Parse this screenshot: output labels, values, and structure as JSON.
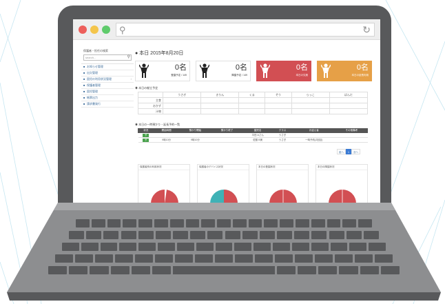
{
  "browser": {
    "search_icon": "search-icon",
    "refresh_icon": "refresh-icon",
    "traffic_lights": [
      "#ed5f5b",
      "#f4c54b",
      "#5fcb6b"
    ]
  },
  "sidebar": {
    "title": "保護者・担任の検索",
    "search_placeholder": "search...",
    "items": [
      {
        "label": "お知らせ管理",
        "icon": "home-icon"
      },
      {
        "label": "出欠管理",
        "icon": "calendar-icon"
      },
      {
        "label": "園児の利用状況管理",
        "icon": "list-icon"
      },
      {
        "label": "保護者管理",
        "icon": "user-icon"
      },
      {
        "label": "園児管理",
        "icon": "child-icon"
      },
      {
        "label": "帳票出力",
        "icon": "print-icon"
      },
      {
        "label": "請求書発行",
        "icon": "document-icon"
      }
    ]
  },
  "main": {
    "page_title": "本日 2015年8月20日",
    "stat_cards": [
      {
        "count": "0名",
        "sub": "登園予定 / 149",
        "style": "white"
      },
      {
        "count": "0名",
        "sub": "降園予定 / 149",
        "style": "white"
      },
      {
        "count": "0名",
        "sub": "本日の欠席",
        "style": "red"
      },
      {
        "count": "0名",
        "sub": "本日の延長利用",
        "style": "orange"
      }
    ],
    "schedule": {
      "title": "本日の献立予定",
      "columns": [
        "",
        "うさぎ",
        "きりん",
        "くま",
        "ぞう",
        "らっこ",
        "ぱんだ"
      ],
      "rows": [
        "主食",
        "おかず",
        "汁物"
      ]
    },
    "list": {
      "title": "本日の一時預かり・延長予約一覧",
      "columns": [
        "状況",
        "開始時間",
        "預かり開始",
        "預かり終了",
        "園児名",
        "クラス",
        "お迎え者",
        "その他備考"
      ],
      "rows": [
        {
          "tag": "予",
          "start": "",
          "from": "",
          "to": "",
          "name": "平田 Aさん",
          "cls": "うさぎ",
          "pickup": "",
          "note": ""
        },
        {
          "tag": "予",
          "start": "9時10分",
          "from": "9時10分",
          "to": "",
          "name": "佐藤 B美",
          "cls": "うさぎ",
          "pickup": "一時予約(2回目)",
          "note": ""
        }
      ]
    },
    "pager": {
      "prev": "前へ",
      "current": "1",
      "next": "次へ"
    },
    "pies": [
      {
        "title": "保護者別の利用状況"
      },
      {
        "title": "保護者のデバイス状況"
      },
      {
        "title": "本日の登園状況"
      },
      {
        "title": "本日の降園状況"
      }
    ]
  },
  "colors": {
    "accent_red": "#d24f53",
    "accent_orange": "#e6a047",
    "tag_green": "#4aa24d",
    "pie_teal": "#3fb2b6"
  }
}
